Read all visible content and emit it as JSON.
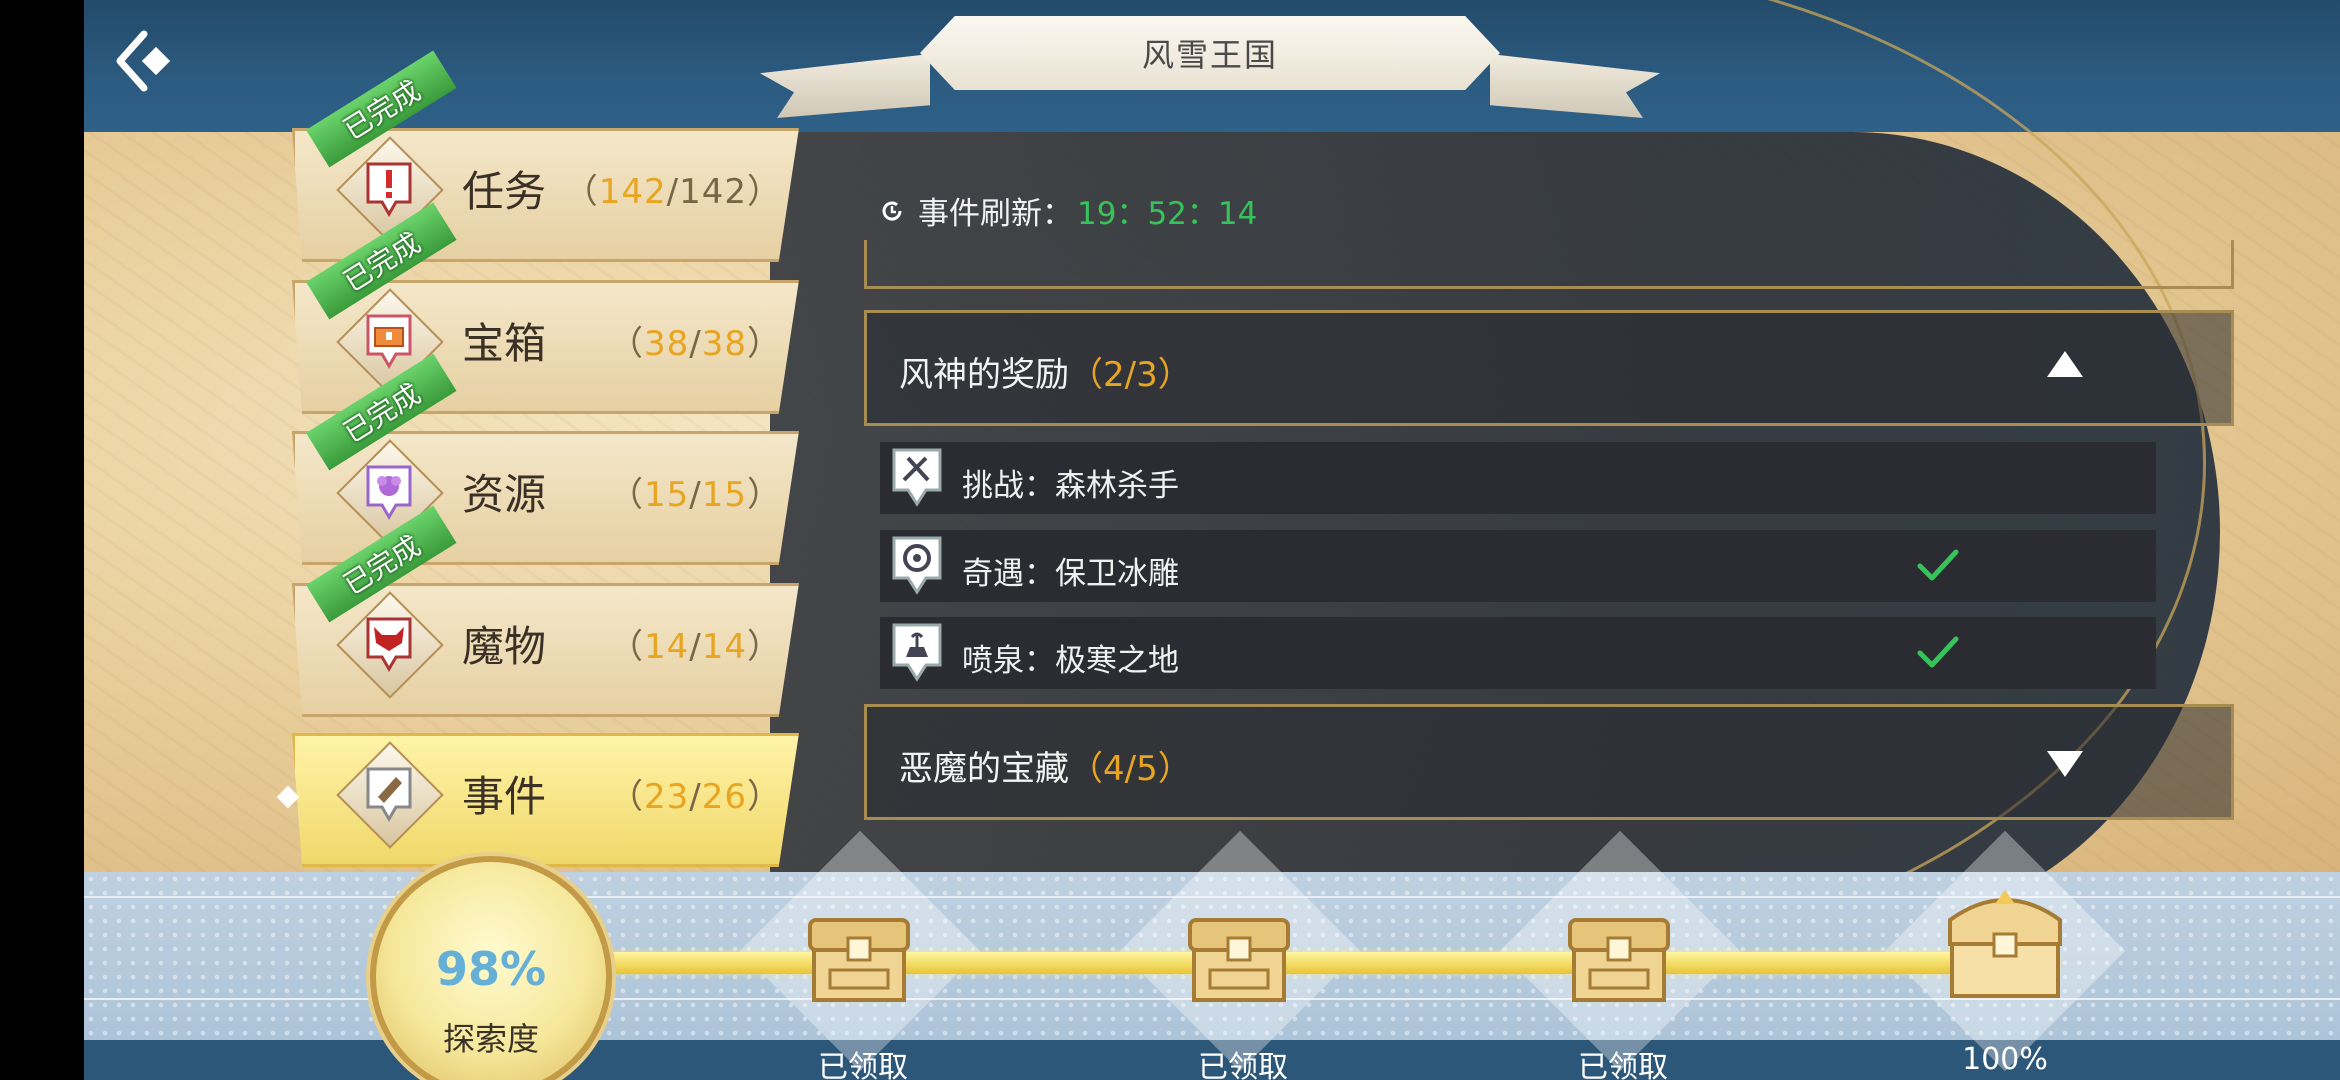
{
  "header": {
    "title": "风雪王国"
  },
  "categories": [
    {
      "label": "任务",
      "done": "142",
      "total": "142",
      "completed": true,
      "badge": "已完成",
      "icon": "quest-icon"
    },
    {
      "label": "宝箱",
      "done": "38",
      "total": "38",
      "completed": true,
      "badge": "已完成",
      "icon": "chest-icon"
    },
    {
      "label": "资源",
      "done": "15",
      "total": "15",
      "completed": true,
      "badge": "已完成",
      "icon": "resource-icon"
    },
    {
      "label": "魔物",
      "done": "14",
      "total": "14",
      "completed": true,
      "badge": "已完成",
      "icon": "monster-icon"
    },
    {
      "label": "事件",
      "done": "23",
      "total": "26",
      "completed": false,
      "selected": true,
      "icon": "event-icon"
    }
  ],
  "events": {
    "refresh_label": "事件刷新：",
    "refresh_time": "19：52：14",
    "sections": [
      {
        "name": "风神的奖励",
        "progress": "（2/3）",
        "expanded": true,
        "items": [
          {
            "label": "挑战：森林杀手",
            "icon": "challenge-icon",
            "done": false
          },
          {
            "label": "奇遇：保卫冰雕",
            "icon": "encounter-icon",
            "done": true
          },
          {
            "label": "喷泉：极寒之地",
            "icon": "fountain-icon",
            "done": true
          }
        ]
      },
      {
        "name": "恶魔的宝藏",
        "progress": "（4/5）",
        "expanded": false
      }
    ]
  },
  "exploration": {
    "percent": "98%",
    "label": "探索度",
    "rewards": [
      {
        "label": "已领取"
      },
      {
        "label": "已领取"
      },
      {
        "label": "已领取"
      },
      {
        "label": "100%"
      }
    ]
  },
  "colors": {
    "accent_gold": "#e8a522",
    "complete_green": "#35c35a",
    "frame_gold": "#a88d52"
  }
}
